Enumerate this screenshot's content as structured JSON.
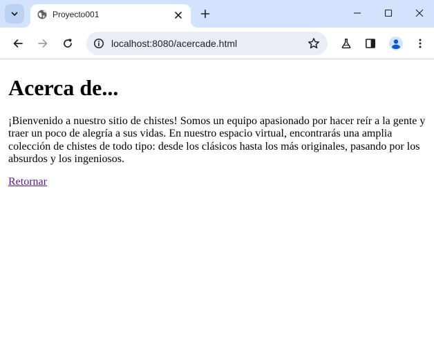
{
  "browser": {
    "tab_title": "Proyecto001",
    "url": "localhost:8080/acercade.html",
    "icons": {
      "tab_search": "chevron-down-icon",
      "favicon": "globe-icon",
      "tab_close": "close-icon",
      "new_tab": "plus-icon",
      "minimize": "minimize-icon",
      "maximize": "maximize-icon",
      "close": "close-icon",
      "back": "arrow-left-icon",
      "forward": "arrow-right-icon",
      "reload": "reload-icon",
      "site_info": "info-icon",
      "bookmark": "star-icon",
      "labs": "flask-icon",
      "side_panel": "side-panel-icon",
      "profile": "person-icon",
      "menu": "kebab-menu-icon"
    },
    "colors": {
      "tabstrip": "#d3e3fd",
      "omnibox": "#e9eef6",
      "profile_accent": "#0b57d0"
    }
  },
  "page": {
    "heading": "Acerca de...",
    "paragraph": "¡Bienvenido a nuestro sitio de chistes! Somos un equipo apasionado por hacer reír a la gente y traer un poco de alegría a sus vidas. En nuestro espacio virtual, encontrarás una amplia colección de chistes de todo tipo: desde los clásicos hasta los más originales, pasando por los absurdos y los ingeniosos.",
    "return_link": "Retornar",
    "colors": {
      "link_visited": "#551a8b"
    }
  }
}
